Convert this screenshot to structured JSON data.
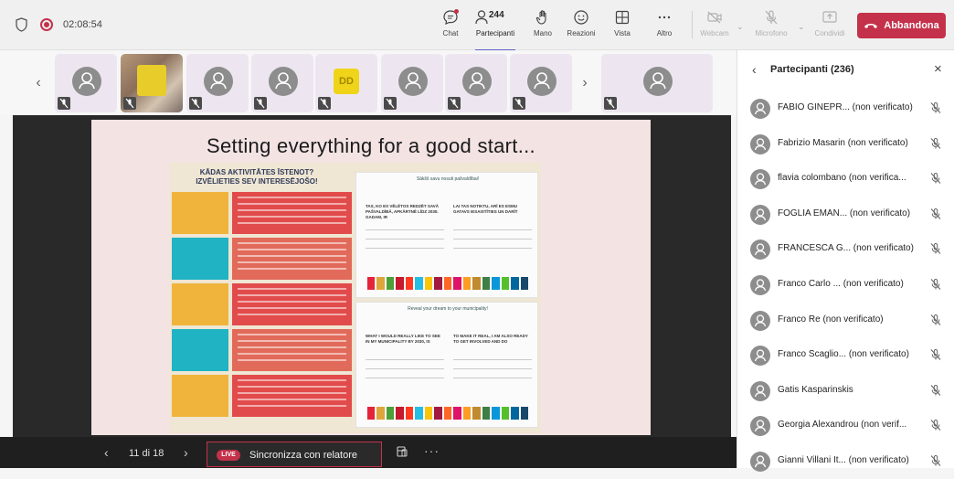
{
  "meeting": {
    "timer": "02:08:54"
  },
  "toolbar": {
    "chat": "Chat",
    "participants": "Partecipanti",
    "participants_count": "244",
    "hand": "Mano",
    "reactions": "Reazioni",
    "view": "Vista",
    "more": "Altro",
    "camera": "Webcam",
    "mic": "Microfono",
    "share": "Condividi",
    "leave": "Abbandona"
  },
  "strip": {
    "initials_tile": "DD"
  },
  "slide": {
    "title": "Setting everything for a good start...",
    "poster_heading": "KĀDAS AKTIVITĀTES ĪSTENOT? IZVĒLIETIES SEV INTERESĒJOŠO!",
    "card1_title": "Sākšš savu nosuti pašvaldībai!",
    "card1_col1": "TAS, KO ES VĒLĒTOS REDZĒT SAVĀ PAŠVALDĪBĀ, APKĀRTNĒ LĪDZ 2030. GADAM, IR",
    "card1_col2": "LAI TAS NOTIKTU, ARĪ ES ESMU GATAVS IESAISTĪTIES UN DARĪT",
    "card2_title": "Reveal your dream to your municipality!",
    "card2_col1": "WHAT I WOULD REALLY LIKE TO SEE IN MY MUNICIPALITY BY 2030, IS",
    "card2_col2": "TO MAKE IT REAL, I AM ALSO READY TO GET INVOLVED AND DO"
  },
  "controls": {
    "page": "11 di 18",
    "live": "LIVE",
    "sync": "Sincronizza con relatore"
  },
  "panel": {
    "title": "Partecipanti (236)",
    "participants": [
      "FABIO GINEPR... (non verificato)",
      "Fabrizio Masarin (non verificato)",
      "flavia colombano (non verifica...",
      "FOGLIA EMAN... (non verificato)",
      "FRANCESCA G... (non verificato)",
      "Franco Carlo ...  (non verificato)",
      "Franco Re (non verificato)",
      "Franco Scaglio... (non verificato)",
      "Gatis Kasparinskis",
      "Georgia Alexandrou (non verif...",
      "Gianni Villani It... (non verificato)"
    ]
  },
  "colors": {
    "leave": "#c4314b",
    "accent": "#5b5fc7",
    "poster_red": "#e24b4b",
    "poster_teal": "#1fb3c4"
  }
}
